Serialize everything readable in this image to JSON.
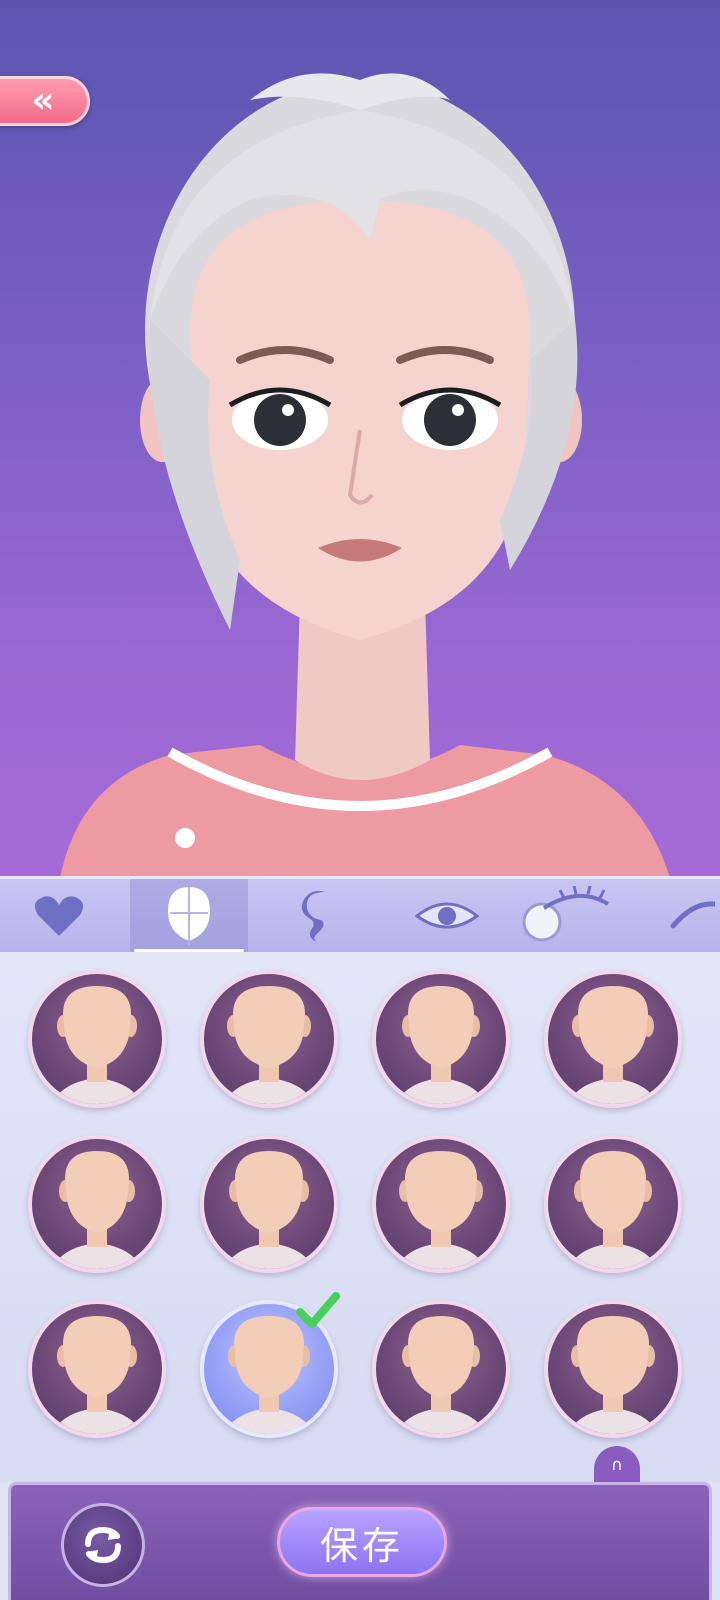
{
  "header": {
    "back_icon": "double-chevron-left-icon",
    "back_glyph": "«"
  },
  "tabs": [
    {
      "name": "favorites",
      "icon": "heart-icon"
    },
    {
      "name": "face-shape",
      "icon": "face-shape-icon",
      "active": true
    },
    {
      "name": "hair",
      "icon": "hair-curl-icon"
    },
    {
      "name": "eyes",
      "icon": "eye-icon"
    },
    {
      "name": "eyelashes",
      "icon": "eyelash-icon"
    },
    {
      "name": "brows",
      "icon": "eyebrow-icon"
    }
  ],
  "face_options": {
    "rows": 3,
    "columns": 4,
    "selected_index": 9
  },
  "actions": {
    "reset_icon": "refresh-icon",
    "save_label": "保存",
    "mini_icon": "headset-icon"
  },
  "colors": {
    "preview_top": "#5b55b0",
    "preview_bottom": "#a56ad6",
    "back_button": "#f46a8a",
    "save_button": "#8a74f2",
    "selected_check": "#46d05a"
  }
}
